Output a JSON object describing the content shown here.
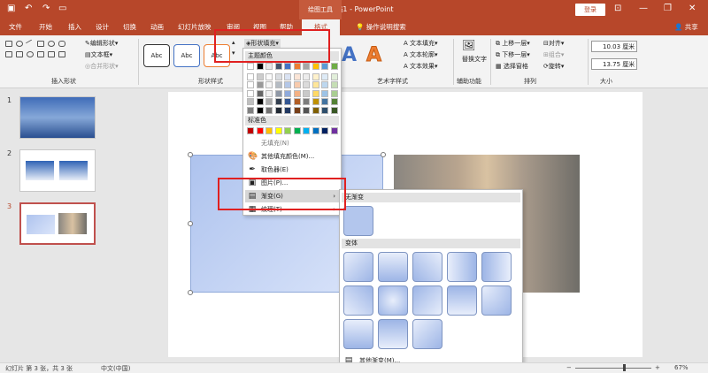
{
  "titlebar": {
    "app_title": "演示文稿1 - PowerPoint",
    "drawing_tools": "绘图工具",
    "login": "登录"
  },
  "tabs": [
    "文件",
    "开始",
    "插入",
    "设计",
    "切换",
    "动画",
    "幻灯片放映",
    "审阅",
    "视图",
    "帮助"
  ],
  "active_tab": "格式",
  "tell_me": "操作说明搜索",
  "share": "共享",
  "ribbon": {
    "edit_shape": "编辑形状",
    "text_box": "文本框",
    "merge_shape": "合并形状",
    "group_insert_shape": "插入形状",
    "style_label": "Abc",
    "group_shape_style": "形状样式",
    "shape_fill": "形状填充",
    "text_fill": "文本填充",
    "text_outline": "文本轮廓",
    "text_effect": "文本效果",
    "group_wordart": "艺术字样式",
    "alt_text": "替换文字",
    "group_accessibility": "辅助功能",
    "bring_forward": "上移一层",
    "send_backward": "下移一层",
    "selection_pane": "选择窗格",
    "align": "对齐",
    "group": "组合",
    "rotate": "旋转",
    "group_arrange": "排列",
    "height": "10.03 厘米",
    "width": "13.75 厘米",
    "group_size": "大小"
  },
  "thumbs": [
    "1",
    "2",
    "3"
  ],
  "fill_menu": {
    "theme_colors": "主题颜色",
    "standard_colors": "标准色",
    "no_fill": "无填充(N)",
    "more_colors": "其他填充颜色(M)...",
    "eyedropper": "取色器(E)",
    "picture": "图片(P)...",
    "gradient": "渐变(G)",
    "texture": "纹理(T)",
    "theme_grid": [
      "#ffffff",
      "#000000",
      "#e7e6e6",
      "#44546a",
      "#4472c4",
      "#ed7d31",
      "#a5a5a5",
      "#ffc000",
      "#5b9bd5",
      "#70ad47"
    ],
    "standard": [
      "#c00000",
      "#ff0000",
      "#ffc000",
      "#ffff00",
      "#92d050",
      "#00b050",
      "#00b0f0",
      "#0070c0",
      "#002060",
      "#7030a0"
    ]
  },
  "gradient_sub": {
    "no_gradient": "无渐变",
    "variants": "变体",
    "more_gradients": "其他渐变(M)..."
  },
  "status": {
    "slide_info": "幻灯片 第 3 张，共 3 张",
    "language": "中文(中国)",
    "zoom": "67%"
  }
}
